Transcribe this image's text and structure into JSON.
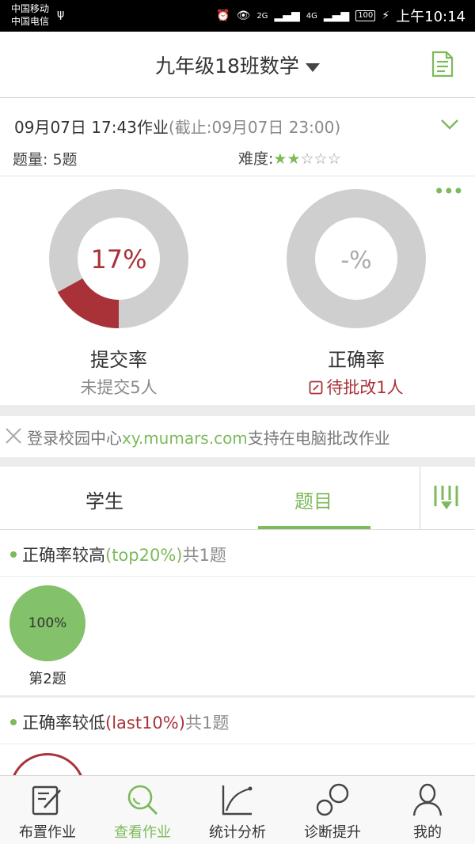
{
  "status_bar": {
    "carrier1": "中国移动",
    "carrier2": "中国电信",
    "net1": "2G",
    "net2": "4G",
    "battery": "100",
    "time": "上午10:14"
  },
  "header": {
    "title": "九年级18班数学"
  },
  "homework": {
    "datetime": "09月07日 17:43作业",
    "deadline": "(截止:09月07日 23:00)",
    "count_label": "题量: 5题",
    "difficulty_label": "难度:",
    "difficulty_rating": 2,
    "difficulty_max": 5,
    "star_filled": "★",
    "star_empty": "☆"
  },
  "stats": {
    "submit": {
      "percent_text": "17%",
      "fraction": 0.17,
      "label": "提交率",
      "sub": "未提交5人"
    },
    "accuracy": {
      "percent_text": "-%",
      "label": "正确率",
      "sub": "待批改1人"
    }
  },
  "notice": {
    "prefix": "登录校园中心",
    "url": "xy.mumars.com",
    "suffix": "支持在电脑批改作业"
  },
  "tabs": [
    {
      "label": "学生",
      "active": false
    },
    {
      "label": "题目",
      "active": true
    }
  ],
  "sections": {
    "high": {
      "title": "正确率较高",
      "tag": "(top20%)",
      "count": "共1题",
      "questions": [
        {
          "percent": "100%",
          "label": "第2题"
        }
      ]
    },
    "low": {
      "title": "正确率较低",
      "tag": "(last10%)",
      "count": "共1题"
    }
  },
  "bottom_nav": [
    {
      "label": "布置作业",
      "icon": "edit-icon",
      "active": false
    },
    {
      "label": "查看作业",
      "icon": "search-icon",
      "active": true
    },
    {
      "label": "统计分析",
      "icon": "chart-icon",
      "active": false
    },
    {
      "label": "诊断提升",
      "icon": "diagnose-icon",
      "active": false
    },
    {
      "label": "我的",
      "icon": "person-icon",
      "active": false
    }
  ],
  "colors": {
    "accent_green": "#7cba5a",
    "accent_red": "#a83238",
    "donut_grey": "#cfcfcf",
    "question_circle": "#83c16a"
  }
}
